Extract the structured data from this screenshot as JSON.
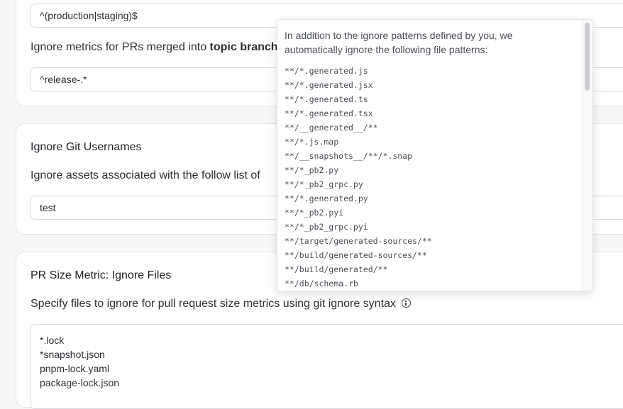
{
  "card1": {
    "env_input_value": "^(production|staging)$",
    "desc_prefix": "Ignore metrics for PRs merged into ",
    "desc_bold": "topic branches",
    "branch_input_value": "^release-.*"
  },
  "card2": {
    "title": "Ignore Git Usernames",
    "desc": "Ignore assets associated with the follow list of",
    "input_value": "test"
  },
  "card3": {
    "title": "PR Size Metric: Ignore Files",
    "desc": "Specify files to ignore for pull request size metrics using git ignore syntax",
    "textarea_lines": [
      "*.lock",
      "*snapshot.json",
      "pnpm-lock.yaml",
      "package-lock.json"
    ]
  },
  "popover": {
    "intro": "In addition to the ignore patterns defined by you, we automatically ignore the following file patterns:",
    "patterns": [
      "**/*.generated.js",
      "**/*.generated.jsx",
      "**/*.generated.ts",
      "**/*.generated.tsx",
      "**/__generated__/**",
      "**/*.js.map",
      "**/__snapshots__/**/*.snap",
      "**/*_pb2.py",
      "**/*_pb2_grpc.py",
      "**/*.generated.py",
      "**/*_pb2.pyi",
      "**/*_pb2_grpc.pyi",
      "**/target/generated-sources/**",
      "**/build/generated-sources/**",
      "**/build/generated/**",
      "**/db/schema.rb"
    ]
  }
}
